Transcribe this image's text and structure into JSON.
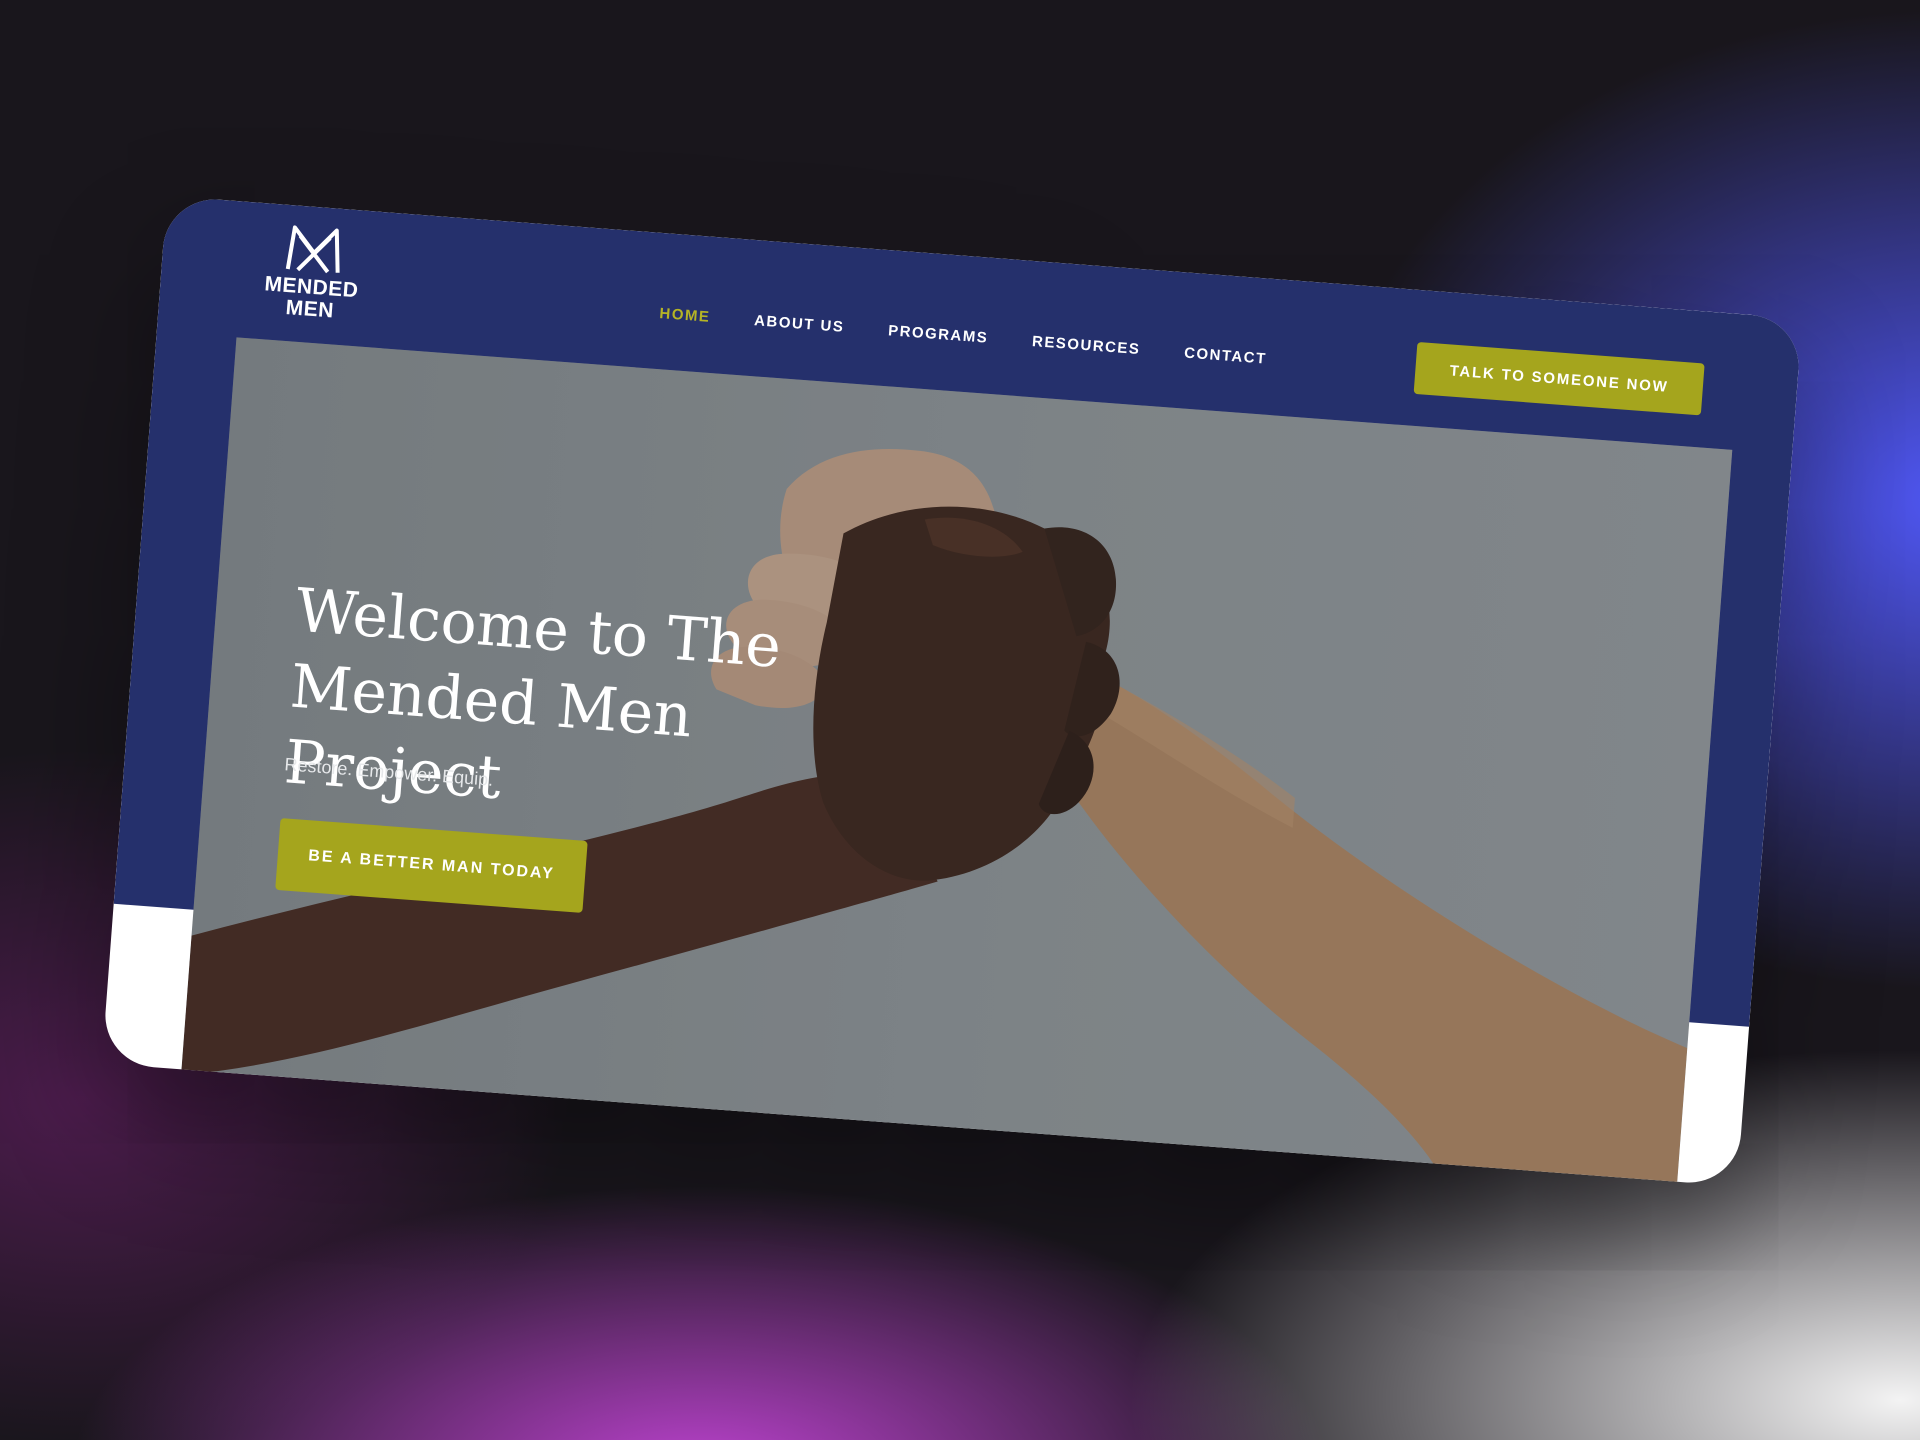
{
  "brand": {
    "logo_line1": "MENDED",
    "logo_line2": "MEN",
    "color_navy": "#25306c",
    "color_olive": "#a5a51d"
  },
  "nav": {
    "items": [
      {
        "label": "HOME",
        "active": true
      },
      {
        "label": "ABOUT US"
      },
      {
        "label": "PROGRAMS"
      },
      {
        "label": "RESOURCES"
      },
      {
        "label": "CONTACT"
      }
    ],
    "cta_label": "TALK TO SOMEONE NOW"
  },
  "hero": {
    "title": "Welcome to The Mended Men Project",
    "tagline": "Restore. Empower. Equip.",
    "cta_label": "BE A BETTER MAN TODAY",
    "image_icon": "clasped-hands-photo"
  }
}
